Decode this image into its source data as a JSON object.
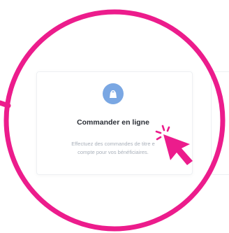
{
  "card": {
    "title": "Commander en ligne",
    "description_line1": "Effectuez des commandes de titre e",
    "description_line2": "compte pour vos bénéficiaires."
  },
  "icons": {
    "card_icon": "shopping-bag-icon",
    "cursor": "click-pointer-icon"
  },
  "colors": {
    "accent": "#ec1c8c",
    "icon_bubble": "#7aa7e3",
    "title_text": "#2b2f36",
    "muted_text": "#a9b0ba"
  }
}
